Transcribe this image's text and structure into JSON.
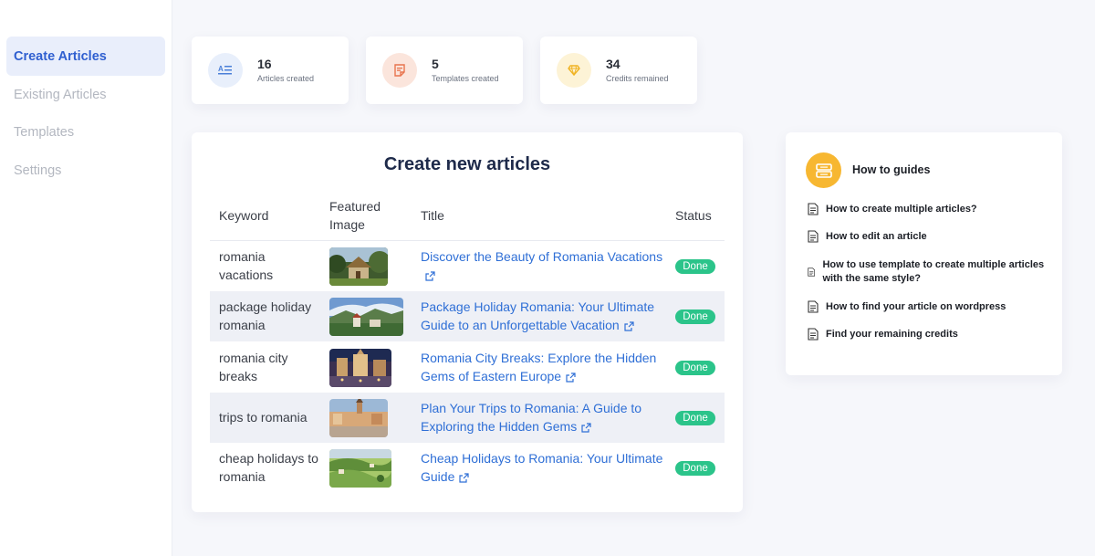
{
  "sidebar": {
    "items": [
      {
        "label": "Create Articles",
        "active": true
      },
      {
        "label": "Existing Articles",
        "active": false
      },
      {
        "label": "Templates",
        "active": false
      },
      {
        "label": "Settings",
        "active": false
      }
    ]
  },
  "stats": [
    {
      "value": "16",
      "label": "Articles created",
      "icon": "article-icon",
      "color": "#4a7fd8",
      "bg": "#e8effb"
    },
    {
      "value": "5",
      "label": "Templates created",
      "icon": "template-icon",
      "color": "#e8744e",
      "bg": "#fbe5dc"
    },
    {
      "value": "34",
      "label": "Credits remained",
      "icon": "diamond-icon",
      "color": "#f0b323",
      "bg": "#fdf3d6"
    }
  ],
  "main": {
    "title": "Create new articles",
    "columns": {
      "keyword": "Keyword",
      "featured_image_line1": "Featured",
      "featured_image_line2": "Image",
      "title": "Title",
      "status": "Status"
    },
    "rows": [
      {
        "keyword": "romania vacations",
        "title": "Discover the Beauty of Romania Vacations",
        "status": "Done",
        "image": "village-house"
      },
      {
        "keyword": "package holiday romania",
        "title": "Package Holiday Romania: Your Ultimate Guide to an Unforgettable Vacation",
        "status": "Done",
        "image": "mountain-town"
      },
      {
        "keyword": "romania city breaks",
        "title": "Romania City Breaks: Explore the Hidden Gems of Eastern Europe",
        "status": "Done",
        "image": "city-night"
      },
      {
        "keyword": "trips to romania",
        "title": "Plan Your Trips to Romania: A Guide to Exploring the Hidden Gems",
        "status": "Done",
        "image": "town-square"
      },
      {
        "keyword": "cheap holidays to romania",
        "title": "Cheap Holidays to Romania: Your Ultimate Guide",
        "status": "Done",
        "image": "green-hills"
      }
    ]
  },
  "guides": {
    "title": "How to guides",
    "items": [
      {
        "label": "How to create multiple articles?"
      },
      {
        "label": "How to edit an article"
      },
      {
        "label": "How to use template to create multiple articles with the same style?"
      },
      {
        "label": "How to find your article on wordpress"
      },
      {
        "label": "Find your remaining credits"
      }
    ]
  },
  "colors": {
    "accent": "#2f5fd0",
    "link": "#2f6fd6",
    "status_done": "#2bc48a",
    "guides_icon": "#f7b731"
  }
}
